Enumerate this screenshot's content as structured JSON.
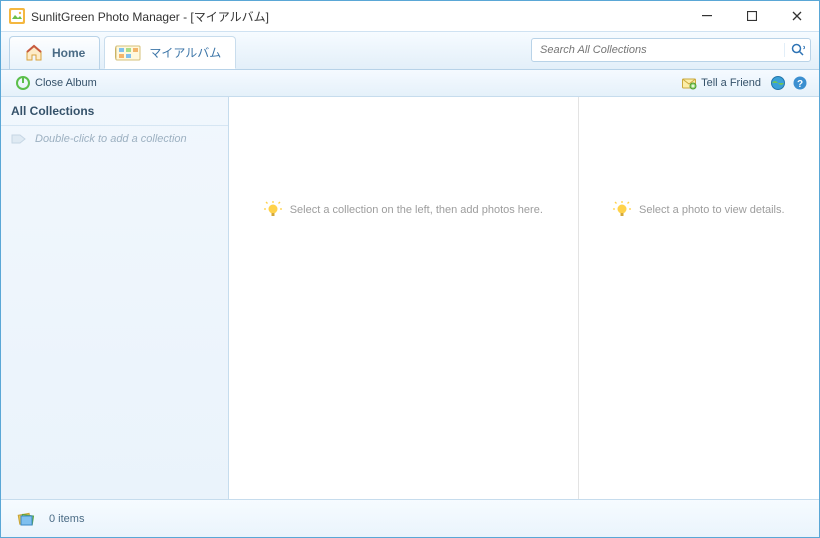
{
  "titlebar": {
    "title": "SunlitGreen Photo Manager - [マイアルバム]"
  },
  "tabs": {
    "home": "Home",
    "album": "マイアルバム"
  },
  "search": {
    "placeholder": "Search All Collections"
  },
  "toolbar": {
    "close_album": "Close Album",
    "tell_friend": "Tell a Friend"
  },
  "sidebar": {
    "header": "All Collections",
    "hint": "Double-click to add a collection"
  },
  "panes": {
    "center_hint": "Select a collection on the left, then add photos here.",
    "right_hint": "Select a photo to view details."
  },
  "status": {
    "items": "0 items"
  }
}
